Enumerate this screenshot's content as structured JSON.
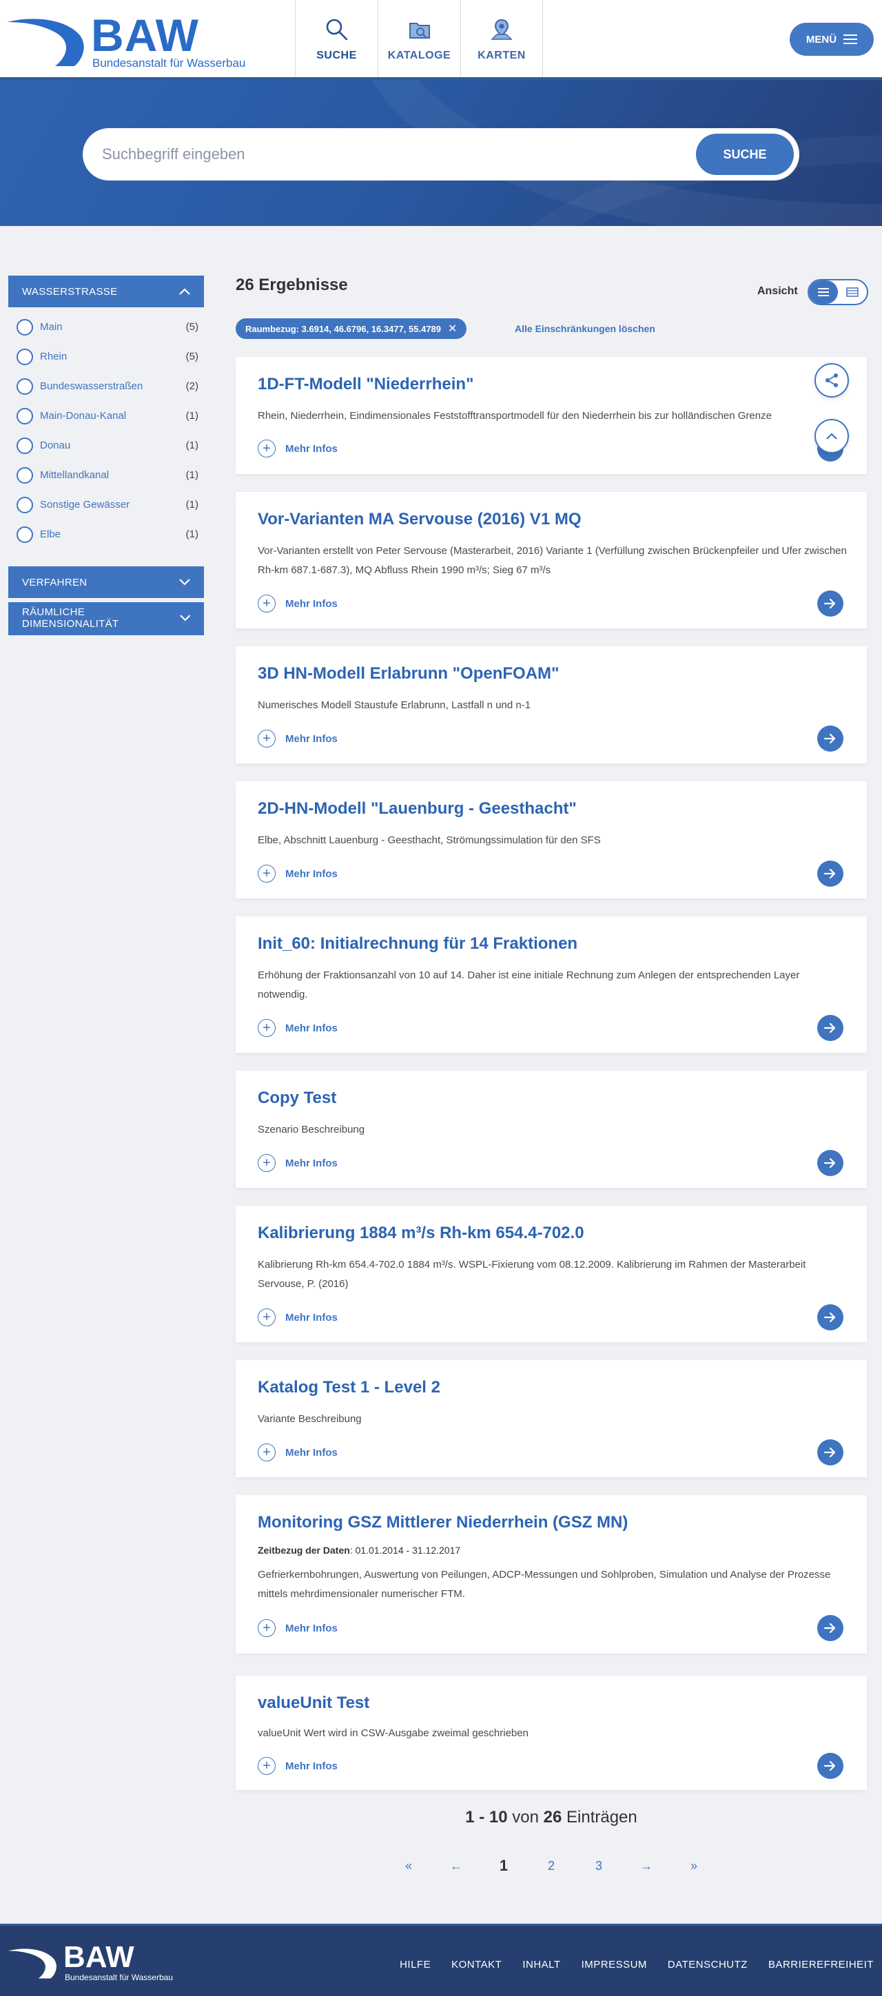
{
  "header": {
    "logo_text": "BAW",
    "logo_sub": "Bundesanstalt für Wasserbau",
    "tabs": [
      {
        "label": "SUCHE",
        "icon": "search-icon"
      },
      {
        "label": "KATALOGE",
        "icon": "catalog-icon"
      },
      {
        "label": "KARTEN",
        "icon": "map-icon"
      }
    ],
    "menu_label": "MENÜ"
  },
  "search": {
    "placeholder": "Suchbegriff eingeben",
    "value": "",
    "button_label": "SUCHE"
  },
  "sidebar": {
    "facets": [
      {
        "title": "WASSERSTRASSE",
        "expanded": true,
        "items": [
          {
            "label": "Main",
            "count": "(5)"
          },
          {
            "label": "Rhein",
            "count": "(5)"
          },
          {
            "label": "Bundeswasserstraßen",
            "count": "(2)"
          },
          {
            "label": "Main-Donau-Kanal",
            "count": "(1)"
          },
          {
            "label": "Donau",
            "count": "(1)"
          },
          {
            "label": "Mittellandkanal",
            "count": "(1)"
          },
          {
            "label": "Sonstige Gewässer",
            "count": "(1)"
          },
          {
            "label": "Elbe",
            "count": "(1)"
          }
        ]
      },
      {
        "title": "VERFAHREN",
        "expanded": false
      },
      {
        "title": "RÄUMLICHE DIMENSIONALITÄT",
        "expanded": false
      }
    ]
  },
  "results": {
    "count_label": "26 Ergebnisse",
    "view_label": "Ansicht",
    "filter_chip": "Raumbezug: 3.6914, 46.6796, 16.3477, 55.4789",
    "clear_label": "Alle Einschränkungen löschen",
    "more_label": "Mehr Infos",
    "items": [
      {
        "title": "1D-FT-Modell \"Niederrhein\"",
        "description": "Rhein, Niederrhein, Eindimensionales Feststofftransportmodell für den Niederrhein bis zur holländischen Grenze"
      },
      {
        "title": "Vor-Varianten MA Servouse (2016) V1 MQ",
        "description": "Vor-Varianten erstellt von Peter Servouse (Masterarbeit, 2016) Variante 1 (Verfüllung zwischen Brückenpfeiler und Ufer zwischen Rh-km 687.1-687.3), MQ Abfluss Rhein 1990 m³/s; Sieg 67 m³/s"
      },
      {
        "title": "3D HN-Modell Erlabrunn \"OpenFOAM\"",
        "description": "Numerisches Modell Staustufe Erlabrunn, Lastfall n und n-1"
      },
      {
        "title": "2D-HN-Modell \"Lauenburg - Geesthacht\"",
        "description": "Elbe, Abschnitt Lauenburg - Geesthacht, Strömungssimulation für den SFS"
      },
      {
        "title": "Init_60: Initialrechnung für 14 Fraktionen",
        "description": "Erhöhung der Fraktionsanzahl von 10 auf 14. Daher ist eine initiale Rechnung zum Anlegen der entsprechenden Layer notwendig."
      },
      {
        "title": "Copy Test",
        "description": "Szenario Beschreibung"
      },
      {
        "title": "Kalibrierung 1884 m³/s Rh-km 654.4-702.0",
        "description": "Kalibrierung Rh-km 654.4-702.0 1884 m³/s. WSPL-Fixierung vom 08.12.2009. Kalibrierung im Rahmen der Masterarbeit Servouse, P. (2016)"
      },
      {
        "title": "Katalog Test 1 - Level 2",
        "description": "Variante Beschreibung"
      },
      {
        "title": "Monitoring GSZ Mittlerer Niederrhein (GSZ MN)",
        "meta_label": "Zeitbezug der Daten",
        "meta_value": ": 01.01.2014 - 31.12.2017",
        "description": "Gefrierkernbohrungen, Auswertung von Peilungen, ADCP-Messungen und Sohlproben, Simulation und Analyse der Prozesse mittels mehrdimensionaler numerischer FTM."
      },
      {
        "title": "valueUnit Test",
        "description": "valueUnit Wert wird in CSW-Ausgabe zweimal geschrieben"
      }
    ]
  },
  "pagination": {
    "info_range": "1 - 10",
    "info_von": "von",
    "info_total": "26",
    "info_suffix": "Einträgen",
    "first": "«",
    "prev": "←",
    "pages": [
      "1",
      "2",
      "3"
    ],
    "current": "1",
    "next": "→",
    "last": "»"
  },
  "footer": {
    "logo_text": "BAW",
    "logo_sub": "Bundesanstalt für Wasserbau",
    "links": [
      "HILFE",
      "KONTAKT",
      "INHALT",
      "IMPRESSUM",
      "DATENSCHUTZ",
      "BARRIEREFREIHEIT"
    ]
  },
  "colors": {
    "primary": "#3f74c0",
    "brand": "#2a6bc7",
    "footer": "#263f6e"
  }
}
